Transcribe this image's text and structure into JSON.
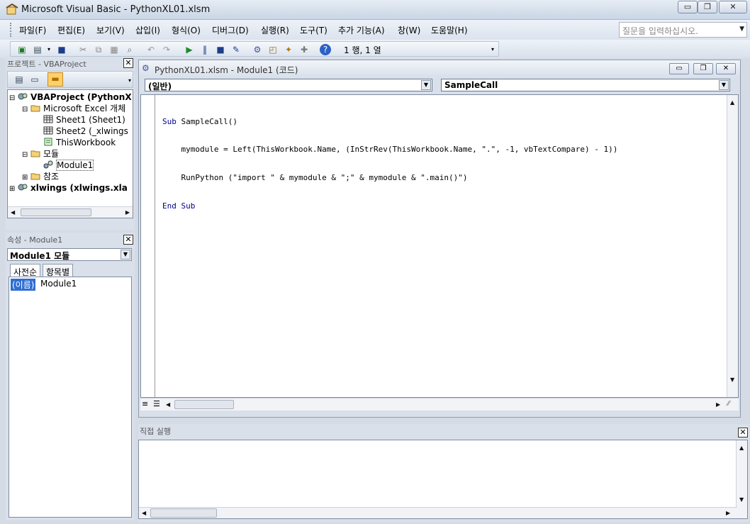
{
  "window": {
    "title": "Microsoft Visual Basic - PythonXL01.xlsm",
    "minimize_icon": "minimize-icon",
    "maximize_icon": "maximize-icon",
    "close_icon": "close-icon"
  },
  "menu": {
    "items": [
      "파일(F)",
      "편집(E)",
      "보기(V)",
      "삽입(I)",
      "형식(O)",
      "디버그(D)",
      "실행(R)",
      "도구(T)",
      "추가 기능(A)",
      "창(W)",
      "도움말(H)"
    ]
  },
  "help_box": {
    "placeholder": "질문을 입력하십시오."
  },
  "toolbar": {
    "cursor_position": "1 행, 1 열"
  },
  "project_pane": {
    "title": "프로젝트 - VBAProject",
    "tree": [
      {
        "label": "VBAProject (PythonX",
        "bold": true,
        "level": 0,
        "expander": "⊟",
        "icon": "project-icon"
      },
      {
        "label": "Microsoft Excel 개체",
        "bold": false,
        "level": 1,
        "expander": "⊟",
        "icon": "folder-icon"
      },
      {
        "label": "Sheet1 (Sheet1)",
        "bold": false,
        "level": 2,
        "expander": "",
        "icon": "sheet-icon"
      },
      {
        "label": "Sheet2 (_xlwings",
        "bold": false,
        "level": 2,
        "expander": "",
        "icon": "sheet-icon"
      },
      {
        "label": "ThisWorkbook",
        "bold": false,
        "level": 2,
        "expander": "",
        "icon": "workbook-icon"
      },
      {
        "label": "모듈",
        "bold": false,
        "level": 1,
        "expander": "⊟",
        "icon": "folder-icon"
      },
      {
        "label": "Module1",
        "bold": false,
        "level": 2,
        "expander": "",
        "icon": "module-icon"
      },
      {
        "label": "참조",
        "bold": false,
        "level": 1,
        "expander": "⊞",
        "icon": "folder-icon"
      },
      {
        "label": "xlwings (xlwings.xla",
        "bold": true,
        "level": 0,
        "expander": "⊞",
        "icon": "project-icon"
      }
    ]
  },
  "props_pane": {
    "title": "속성 - Module1",
    "selector": "Module1 모듈",
    "tabs": [
      "사전순",
      "항목별"
    ],
    "prop_name": "(이름)",
    "prop_value": "Module1"
  },
  "code_window": {
    "title": "PythonXL01.xlsm - Module1 (코드)",
    "object_combo": "(일반)",
    "proc_combo": "SampleCall",
    "lines": [
      "Sub SampleCall()",
      "    mymodule = Left(ThisWorkbook.Name, (InStrRev(ThisWorkbook.Name, \".\", -1, vbTextCompare) - 1))",
      "    RunPython (\"import \" & mymodule & \";\" & mymodule & \".main()\")",
      "End Sub"
    ]
  },
  "immediate_pane": {
    "title": "직접 실행"
  }
}
